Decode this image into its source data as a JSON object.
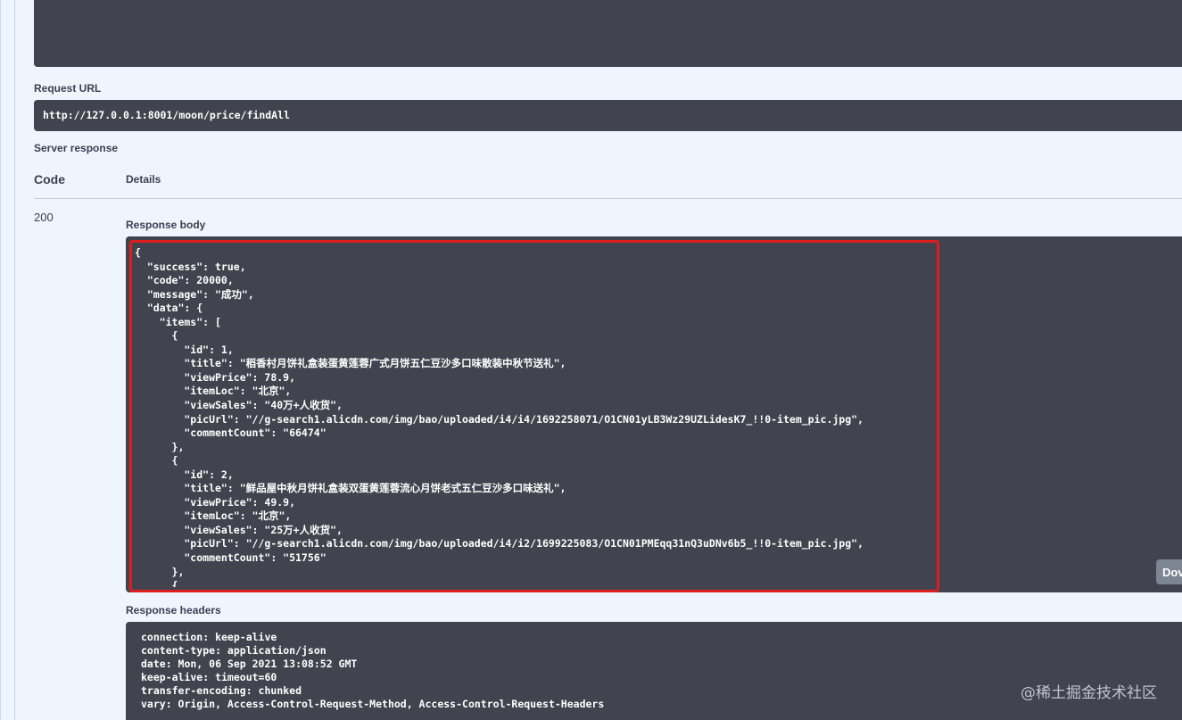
{
  "request_url": {
    "label": "Request URL",
    "value": "http://127.0.0.1:8001/moon/price/findAll"
  },
  "server_response": {
    "label": "Server response",
    "col_code": "Code",
    "col_details": "Details",
    "status_code": "200",
    "response_body_label": "Response body",
    "response_body_text": "{\n  \"success\": true,\n  \"code\": 20000,\n  \"message\": \"成功\",\n  \"data\": {\n    \"items\": [\n      {\n        \"id\": 1,\n        \"title\": \"稻香村月饼礼盒装蛋黄莲蓉广式月饼五仁豆沙多口味散装中秋节送礼\",\n        \"viewPrice\": 78.9,\n        \"itemLoc\": \"北京\",\n        \"viewSales\": \"40万+人收货\",\n        \"picUrl\": \"//g-search1.alicdn.com/img/bao/uploaded/i4/i4/1692258071/O1CN01yLB3Wz29UZLidesK7_!!0-item_pic.jpg\",\n        \"commentCount\": \"66474\"\n      },\n      {\n        \"id\": 2,\n        \"title\": \"鲜品屋中秋月饼礼盒装双蛋黄莲蓉流心月饼老式五仁豆沙多口味送礼\",\n        \"viewPrice\": 49.9,\n        \"itemLoc\": \"北京\",\n        \"viewSales\": \"25万+人收货\",\n        \"picUrl\": \"//g-search1.alicdn.com/img/bao/uploaded/i4/i2/1699225083/O1CN01PMEqq31nQ3uDNv6b5_!!0-item_pic.jpg\",\n        \"commentCount\": \"51756\"\n      },\n      {",
    "download_label": "Dov",
    "response_headers_label": "Response headers",
    "response_headers_text": "connection: keep-alive\ncontent-type: application/json\ndate: Mon, 06 Sep 2021 13:08:52 GMT\nkeep-alive: timeout=60\ntransfer-encoding: chunked\nvary: Origin, Access-Control-Request-Method, Access-Control-Request-Headers"
  },
  "watermark": "@稀土掘金技术社区"
}
